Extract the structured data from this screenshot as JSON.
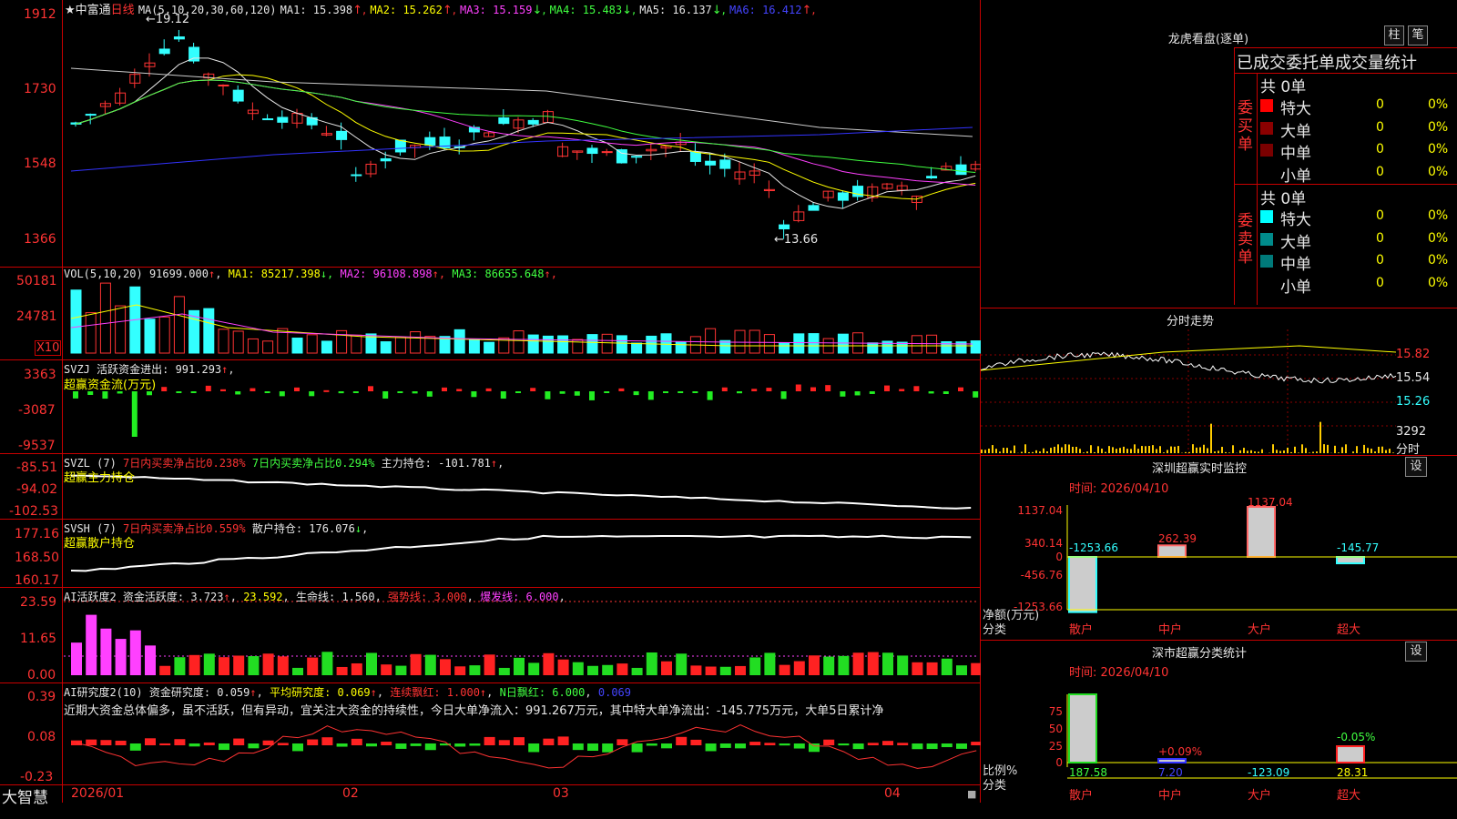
{
  "main": {
    "y_ticks": [
      "1912",
      "1730",
      "1548",
      "1366"
    ],
    "header": {
      "title": "★中富通",
      "period": "日线",
      "ma_params": "MA(5,10,20,30,60,120)",
      "items": [
        {
          "label": "MA1: 15.398",
          "arrow": "↑",
          "color": "#e6e6e6"
        },
        {
          "label": "MA2: 15.262",
          "arrow": "↑",
          "color": "#ffff00"
        },
        {
          "label": "MA3: 15.159",
          "arrow": "↓",
          "color": "#ff40ff"
        },
        {
          "label": "MA4: 15.483",
          "arrow": "↓",
          "color": "#40ff40"
        },
        {
          "label": "MA5: 16.137",
          "arrow": "↓",
          "color": "#e6e6e6"
        },
        {
          "label": "MA6: 16.412",
          "arrow": "↑",
          "color": "#4444ff"
        }
      ]
    },
    "high_label": "←19.12",
    "low_label": "←13.66"
  },
  "vol": {
    "y_ticks": [
      "50181",
      "24781"
    ],
    "unit": "X10",
    "header": "VOL(5,10,20)",
    "value": "91699.000",
    "items": [
      {
        "label": "MA1: 85217.398",
        "arrow": "↓",
        "color": "#ffff00"
      },
      {
        "label": "MA2: 96108.898",
        "arrow": "↑",
        "color": "#ff40ff"
      },
      {
        "label": "MA3: 86655.648",
        "arrow": "↑",
        "color": "#40ff40"
      }
    ]
  },
  "svzj": {
    "y_ticks": [
      "3363",
      "-3087",
      "-9537"
    ],
    "header": "SVZJ  活跃资金进出: 991.293",
    "header_arrow": "↑",
    "subtitle": "超赢资金流(万元)"
  },
  "svzl": {
    "y_ticks": [
      "-85.51",
      "-94.02",
      "-102.53"
    ],
    "header_name": "SVZL (7)",
    "part1": "7日内买卖净占比0.238%",
    "part2": "7日内买卖净占比0.294%",
    "part3": "主力持仓: -101.781",
    "part3_arrow": "↑",
    "subtitle": "超赢主力持仓"
  },
  "svsh": {
    "y_ticks": [
      "177.16",
      "168.50",
      "160.17"
    ],
    "header_name": "SVSH (7)",
    "part1": "7日内买卖净占比0.559%",
    "part3": "散户持仓: 176.076",
    "part3_arrow": "↓",
    "subtitle": "超赢散户持仓"
  },
  "ai_active": {
    "y_ticks": [
      "23.59",
      "11.65",
      "0.00"
    ],
    "name": "AI活跃度2",
    "part1": "资金活跃度: 3.723",
    "part1_arrow": "↑",
    "part2": "23.592",
    "part3": "生命线: 1.560",
    "part4": "强势线: 3.000",
    "part5": "爆发线: 6.000"
  },
  "ai_research": {
    "y_ticks": [
      "0.39",
      "0.08",
      "-0.23"
    ],
    "name": "AI研究度2(10)",
    "part1": "资金研究度: 0.059",
    "part1_arrow": "↑",
    "part2": "平均研究度: 0.069",
    "part2_arrow": "↑",
    "part3": "连续飘红: 1.000",
    "part3_arrow": "↑",
    "part4": "N日飘红: 6.000",
    "part5": "0.069",
    "comment": "近期大资金总体偏多，虽不活跃，但有异动，宜关注大资金的持续性，今日大单净流入：991.267万元，其中特大单净流出：-145.775万元，大单5日累计净"
  },
  "x_axis": {
    "labels": [
      "2026/01",
      "02",
      "03",
      "04"
    ],
    "brand": "大智慧"
  },
  "right": {
    "dragon": {
      "title": "龙虎看盘(逐单)",
      "btn1": "柱",
      "btn2": "笔",
      "header": "已成交委托单成交量统计",
      "buy_label": "委买单",
      "sell_label": "委卖单",
      "buy_total": "共 0单",
      "sell_total": "共 0单",
      "rows": [
        {
          "label": "特大",
          "value": "0",
          "pct": "0%"
        },
        {
          "label": "大单",
          "value": "0",
          "pct": "0%"
        },
        {
          "label": "中单",
          "value": "0",
          "pct": "0%"
        },
        {
          "label": "小单",
          "value": "0",
          "pct": "0%"
        }
      ],
      "buy_colors": [
        "#ff0000",
        "#8b0000",
        "#7a0000",
        "#000000"
      ],
      "sell_colors": [
        "#00ffff",
        "#008b8b",
        "#007a7a",
        "#000000"
      ]
    },
    "minute": {
      "title": "分时走势",
      "ticks": [
        "15.82",
        "15.54",
        "15.26",
        "3292",
        "分时"
      ]
    },
    "sz_monitor": {
      "title": "深圳超赢实时监控",
      "btn": "设",
      "time": "时间: 2026/04/10",
      "y_ticks": [
        "1137.04",
        "340.14",
        "0",
        "-456.76",
        "-1253.66"
      ],
      "ylabel": "净额(万元)",
      "xlabel": "分类",
      "categories": [
        "散户",
        "中户",
        "大户",
        "超大"
      ],
      "values": [
        -1253.66,
        262.39,
        1137.04,
        -145.77
      ],
      "value_labels": [
        "-1253.66",
        "262.39",
        "1137.04",
        "-145.77"
      ]
    },
    "sz_stat": {
      "title": "深市超赢分类统计",
      "btn": "设",
      "time": "时间: 2026/04/10",
      "y_ticks": [
        "75",
        "50",
        "25",
        "0"
      ],
      "ylabel": "比例%",
      "xlabel": "分类",
      "categories": [
        "散户",
        "中户",
        "大户",
        "超大"
      ],
      "bar_labels": [
        "",
        "+0.09%",
        "",
        "-0.05%"
      ],
      "bottom_values": [
        "187.58",
        "7.20",
        "-123.09",
        "28.31"
      ]
    }
  }
}
